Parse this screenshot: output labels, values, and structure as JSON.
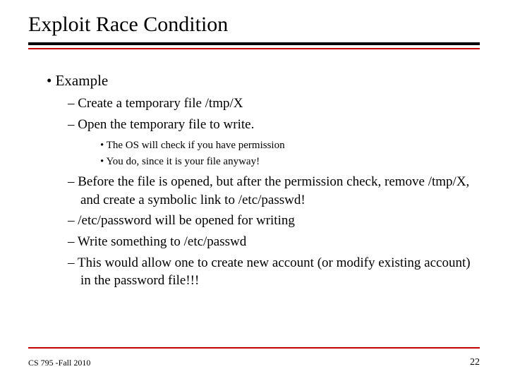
{
  "title": "Exploit Race Condition",
  "bullets": {
    "example": "Example",
    "sub": [
      "Create a temporary file /tmp/X",
      "Open the temporary file to write."
    ],
    "subsub": [
      "The OS will check if you have permission",
      "You do, since it is your file anyway!"
    ],
    "sub2": [
      "Before the file is opened, but after the permission check, remove /tmp/X, and create a symbolic link to /etc/passwd!",
      "/etc/password will be opened for writing",
      "Write something to /etc/passwd",
      "This would allow one to create new account (or modify existing account) in the password file!!!"
    ]
  },
  "footer": {
    "left": "CS 795 -Fall 2010",
    "page": "22"
  }
}
